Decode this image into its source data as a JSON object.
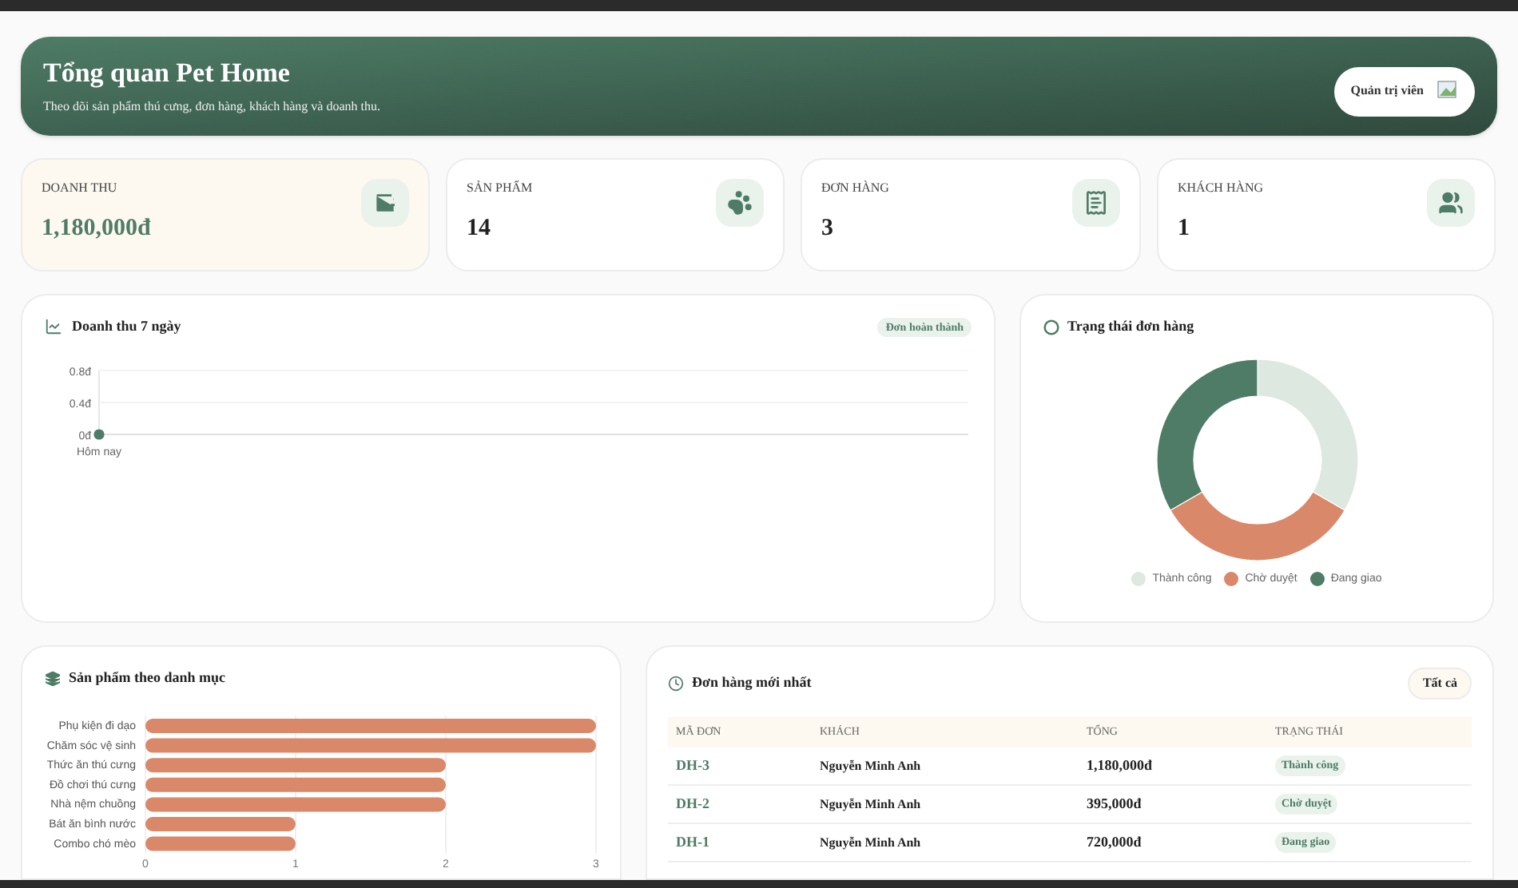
{
  "header": {
    "title": "Tổng quan Pet Home",
    "subtitle": "Theo dõi sản phẩm thú cưng, đơn hàng, khách hàng và doanh thu.",
    "user": "Quản trị viên"
  },
  "stats": [
    {
      "label": "DOANH THU",
      "value": "1,180,000đ",
      "kind": "wallet",
      "highlighted": true
    },
    {
      "label": "SẢN PHẨM",
      "value": "14",
      "kind": "paw",
      "highlighted": false
    },
    {
      "label": "ĐƠN HÀNG",
      "value": "3",
      "kind": "receipt",
      "highlighted": false
    },
    {
      "label": "KHÁCH HÀNG",
      "value": "1",
      "kind": "users",
      "highlighted": false
    }
  ],
  "revenue_panel": {
    "title": "Doanh thu 7 ngày",
    "badge": "Đơn hoàn thành",
    "chart_data": {
      "type": "line",
      "categories": [
        "Hôm nay"
      ],
      "values": [
        0
      ],
      "color": "#4e7c66",
      "marker": true,
      "ylim": [
        0,
        0.8
      ],
      "yticks": [
        {
          "value": 0,
          "label": "0đ"
        },
        {
          "value": 0.4,
          "label": "0.4đ"
        },
        {
          "value": 0.8,
          "label": "0.8đ"
        }
      ]
    }
  },
  "status_panel": {
    "title": "Trạng thái đơn hàng",
    "chart_data": {
      "type": "donut",
      "categories": [
        "Thành công",
        "Chờ duyệt",
        "Đang giao"
      ],
      "values": [
        33.33,
        33.33,
        33.34
      ],
      "colors": [
        "#dce8e0",
        "#d9886a",
        "#4e7c66"
      ]
    }
  },
  "category_panel": {
    "title": "Sản phẩm theo danh mục",
    "chart_data": {
      "type": "bar",
      "orientation": "horizontal",
      "categories": [
        "Phụ kiện đi dạo",
        "Chăm sóc vệ sinh",
        "Thức ăn thú cưng",
        "Đồ chơi thú cưng",
        "Nhà nệm chuồng",
        "Bát ăn bình nước",
        "Combo chó mèo"
      ],
      "values": [
        3,
        3,
        2,
        2,
        2,
        1,
        1
      ],
      "xlim": [
        0,
        3
      ],
      "xticks": [
        0,
        1,
        2,
        3
      ]
    }
  },
  "orders_panel": {
    "title": "Đơn hàng mới nhất",
    "button": "Tất cả",
    "columns": [
      "MÃ ĐƠN",
      "KHÁCH",
      "TỔNG",
      "TRẠNG THÁI"
    ],
    "rows": [
      {
        "id": "DH-3",
        "customer": "Nguyễn Minh Anh",
        "total": "1,180,000đ",
        "status": "Thành công"
      },
      {
        "id": "DH-2",
        "customer": "Nguyễn Minh Anh",
        "total": "395,000đ",
        "status": "Chờ duyệt"
      },
      {
        "id": "DH-1",
        "customer": "Nguyễn Minh Anh",
        "total": "720,000đ",
        "status": "Đang giao"
      }
    ]
  }
}
